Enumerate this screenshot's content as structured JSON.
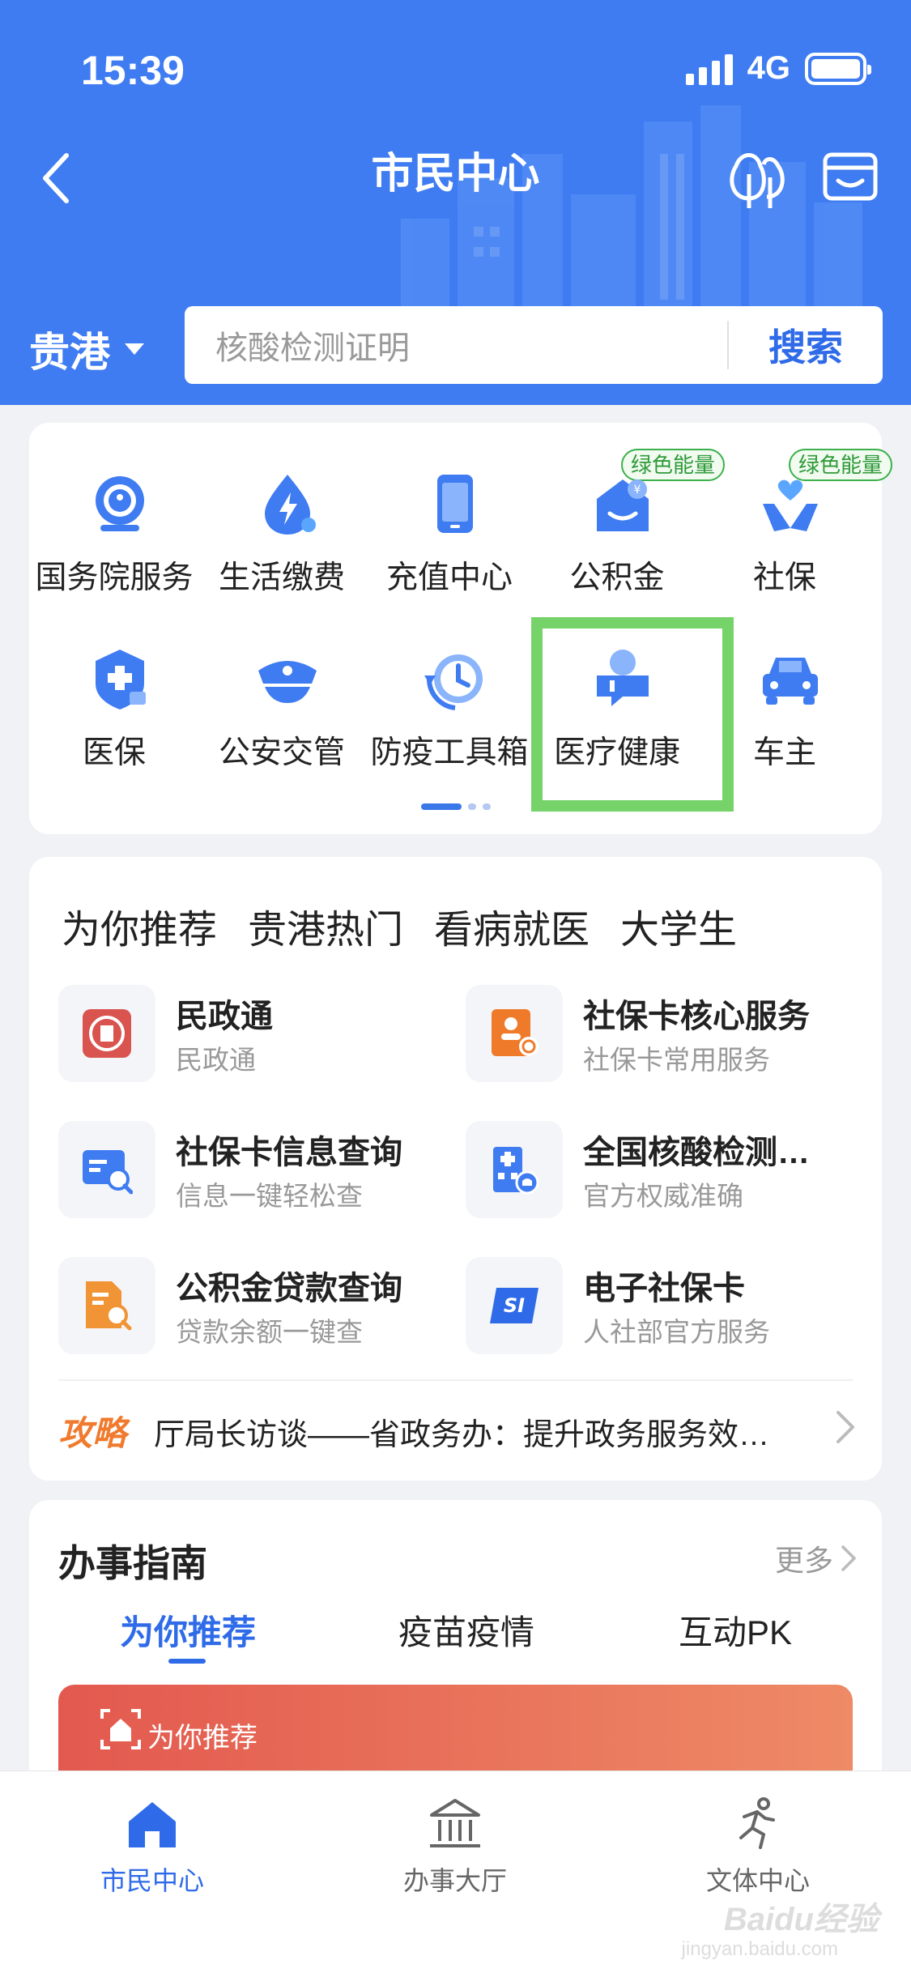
{
  "status_bar": {
    "time": "15:39",
    "network": "4G"
  },
  "header": {
    "title": "市民中心"
  },
  "search": {
    "city": "贵港",
    "placeholder": "核酸检测证明",
    "button": "搜索"
  },
  "services": {
    "items": [
      {
        "label": "国务院服务",
        "icon": "state-council-icon"
      },
      {
        "label": "生活缴费",
        "icon": "utility-payment-icon"
      },
      {
        "label": "充值中心",
        "icon": "recharge-icon"
      },
      {
        "label": "公积金",
        "icon": "housing-fund-icon",
        "badge": "绿色能量"
      },
      {
        "label": "社保",
        "icon": "social-security-icon",
        "badge": "绿色能量"
      },
      {
        "label": "医保",
        "icon": "medical-insurance-icon"
      },
      {
        "label": "公安交管",
        "icon": "police-cap-icon"
      },
      {
        "label": "防疫工具箱",
        "icon": "epidemic-clock-icon"
      },
      {
        "label": "医疗健康",
        "icon": "healthcare-icon"
      },
      {
        "label": "车主",
        "icon": "car-icon"
      }
    ]
  },
  "recommend": {
    "tabs": [
      "为你推荐",
      "贵港热门",
      "看病就医",
      "大学生"
    ],
    "items": [
      {
        "title": "民政通",
        "subtitle": "民政通",
        "icon": "civil-affairs-icon",
        "color": "#d9534f"
      },
      {
        "title": "社保卡核心服务",
        "subtitle": "社保卡常用服务",
        "icon": "social-card-service-icon",
        "color": "#ef7a2a"
      },
      {
        "title": "社保卡信息查询",
        "subtitle": "信息一键轻松查",
        "icon": "card-search-icon",
        "color": "#3f7cf2"
      },
      {
        "title": "全国核酸检测…",
        "subtitle": "官方权威准确",
        "icon": "hospital-icon",
        "color": "#3f7cf2"
      },
      {
        "title": "公积金贷款查询",
        "subtitle": "贷款余额一键查",
        "icon": "document-search-icon",
        "color": "#f19435"
      },
      {
        "title": "电子社保卡",
        "subtitle": "人社部官方服务",
        "icon": "si-card-icon",
        "color": "#2f6be8"
      }
    ],
    "news": {
      "tag": "攻略",
      "text": "厅局长访谈——省政务办：提升政务服务效…"
    }
  },
  "guide": {
    "title": "办事指南",
    "more": "更多",
    "tabs": [
      "为你推荐",
      "疫苗疫情",
      "互动PK"
    ],
    "banner_label": "为你推荐"
  },
  "bottom_nav": [
    {
      "label": "市民中心",
      "icon": "home-icon"
    },
    {
      "label": "办事大厅",
      "icon": "government-hall-icon"
    },
    {
      "label": "文体中心",
      "icon": "running-icon"
    }
  ],
  "watermark": {
    "text": "Baidu经验",
    "sub": "jingyan.baidu.com"
  },
  "colors": {
    "primary": "#3f7cf2",
    "highlight": "#76d36a",
    "badge": "#3bb04c",
    "news_tag": "#f07a2e"
  }
}
